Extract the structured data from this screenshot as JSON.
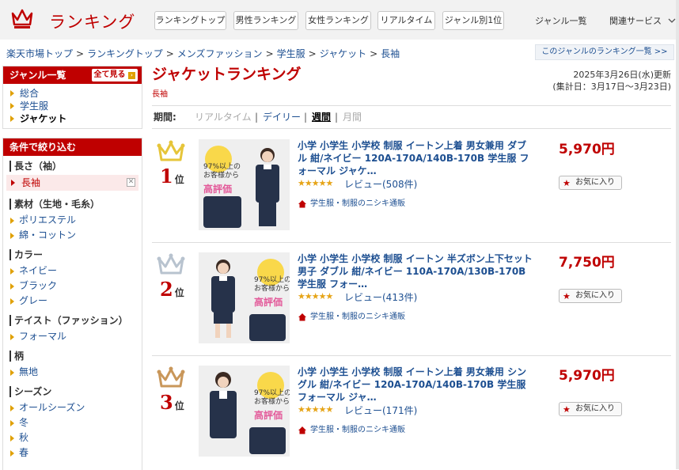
{
  "header": {
    "logo_text": "ランキング",
    "nav_buttons": [
      "ランキングトップ",
      "男性ランキング",
      "女性ランキング",
      "リアルタイム",
      "ジャンル別1位"
    ],
    "genre_list": "ジャンル一覧",
    "related": "関連サービス"
  },
  "breadcrumb": [
    "楽天市場トップ",
    "ランキングトップ",
    "メンズファッション",
    "学生服",
    "ジャケット",
    "長袖"
  ],
  "genre_ranking_link": "このジャンルのランキング一覧 >>",
  "sidebar": {
    "genre_title": "ジャンル一覧",
    "see_all": "全て見る",
    "genre_items": [
      {
        "label": "総合"
      },
      {
        "label": "学生服"
      },
      {
        "label": "ジャケット"
      }
    ],
    "filter_title": "条件で絞り込む",
    "sections": [
      {
        "title": "長さ（袖）",
        "selected": "長袖",
        "items": []
      },
      {
        "title": "素材（生地・毛糸）",
        "items": [
          "ポリエステル",
          "綿・コットン"
        ]
      },
      {
        "title": "カラー",
        "items": [
          "ネイビー",
          "ブラック",
          "グレー"
        ]
      },
      {
        "title": "テイスト（ファッション）",
        "items": [
          "フォーマル"
        ]
      },
      {
        "title": "柄",
        "items": [
          "無地"
        ]
      },
      {
        "title": "シーズン",
        "items": [
          "オールシーズン",
          "冬",
          "秋",
          "春"
        ]
      }
    ]
  },
  "main": {
    "title": "ジャケットランキング",
    "subtitle": "長袖",
    "updated": "2025年3月26日(水)更新",
    "period_range": "(集計日：3月17日〜3月23日)",
    "period_label": "期間:",
    "period_options": [
      "リアルタイム",
      "デイリー",
      "週間",
      "月間"
    ]
  },
  "items": [
    {
      "rank": "1",
      "rank_suffix": "位",
      "title": "小学 小学生 小学校 制服 イートン上着 男女兼用 ダブル 紺/ネイビー 120A-170A/140B-170B 学生服 フォーマル ジャケ…",
      "rating": "★★★★★",
      "review": "レビュー(508件)",
      "shop": "学生服・制服のニシキ通販",
      "price": "5,970円",
      "fav": "お気に入り",
      "img_text1": "97%以上の お客様から",
      "img_text2": "高評価",
      "crown_color": "#e6c53a"
    },
    {
      "rank": "2",
      "rank_suffix": "位",
      "title": "小学 小学生 小学校 制服 イートン 半ズボン上下セット 男子 ダブル 紺/ネイビー 110A-170A/130B-170B 学生服 フォー…",
      "rating": "★★★★★",
      "review": "レビュー(413件)",
      "shop": "学生服・制服のニシキ通販",
      "price": "7,750円",
      "fav": "お気に入り",
      "img_text1": "97%以上の お客様から",
      "img_text2": "高評価",
      "crown_color": "#b8c3cf"
    },
    {
      "rank": "3",
      "rank_suffix": "位",
      "title": "小学 小学生 小学校 制服 イートン上着 男女兼用 シングル 紺/ネイビー 120A-170A/140B-170B 学生服 フォーマル ジャ…",
      "rating": "★★★★★",
      "review": "レビュー(171件)",
      "shop": "学生服・制服のニシキ通販",
      "price": "5,970円",
      "fav": "お気に入り",
      "img_text1": "97%以上の お客様から",
      "img_text2": "高評価",
      "crown_color": "#c9975a"
    }
  ]
}
